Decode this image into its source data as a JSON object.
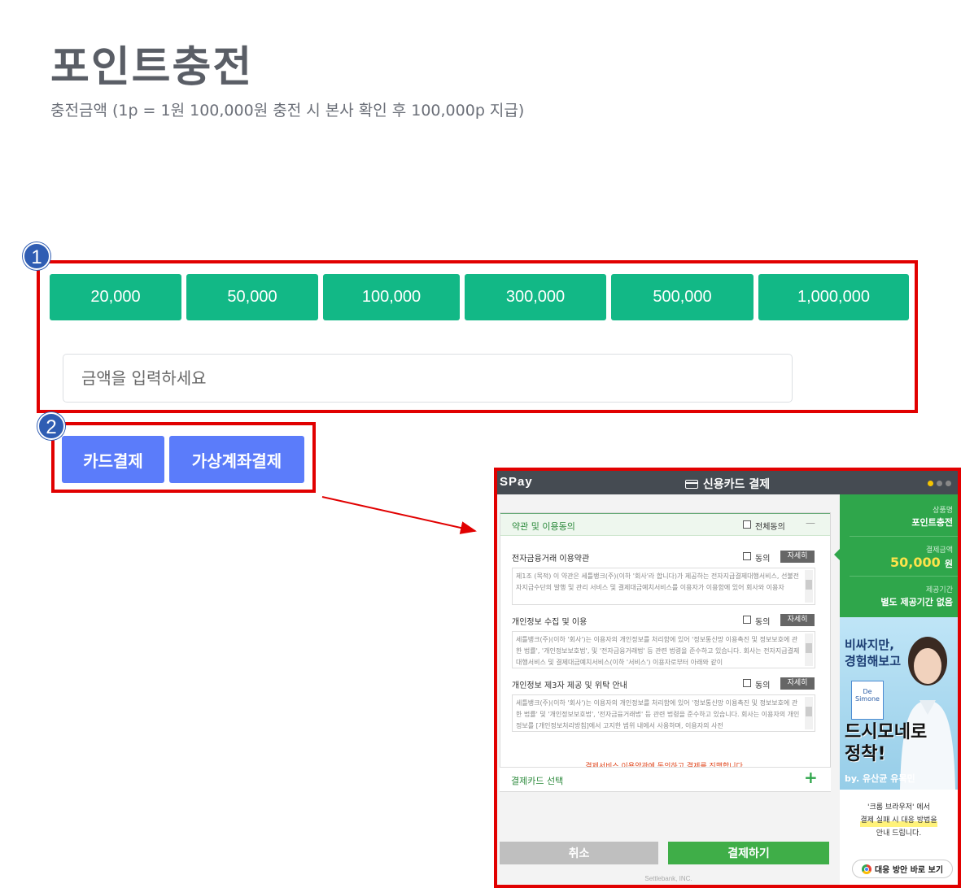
{
  "page": {
    "title": "포인트충전",
    "subtitle": "충전금액 (1p = 1원 100,000원 충전 시 본사 확인 후 100,000p 지급)"
  },
  "annotations": {
    "badge1": "1",
    "badge2": "2",
    "color": "#e10000"
  },
  "amount_buttons": [
    "20,000",
    "50,000",
    "100,000",
    "300,000",
    "500,000",
    "1,000,000"
  ],
  "amount_input": {
    "placeholder": "금액을 입력하세요",
    "value": ""
  },
  "payment_buttons": {
    "card": "카드결제",
    "virtual_account": "가상계좌결제"
  },
  "popup": {
    "logo": "SPay",
    "title": "신용카드 결제",
    "terms": {
      "header": "약관 및 이용동의",
      "agree_all": "전체동의",
      "collapse": "—",
      "items": [
        {
          "title": "전자금융거래 이용약관",
          "agree": "동의",
          "detail": "자세히",
          "text": "제1조 (목적) 이 약관은 세틀뱅크(주)(이하 '회사'라 합니다)가 제공하는 전자지급결제대행서비스, 선불전자지급수단의 발행 및 관리 서비스 및 결제대금예치서비스를 이용자가 이용함에 있어 회사와 이용자"
        },
        {
          "title": "개인정보 수집 및 이용",
          "agree": "동의",
          "detail": "자세히",
          "text": "세틀뱅크(주)(이하 '회사')는 이용자의 개인정보를 처리함에 있어 '정보통신망 이용촉진 및 정보보호에 관한 법률', '개인정보보호법', 및 '전자금융거래법' 등 관련 법령을 준수하고 있습니다. 회사는 전자지급결제대행서비스 및 결제대금예치서비스(이하 '서비스') 이용자로부터 아래와 같이"
        },
        {
          "title": "개인정보 제3자 제공 및 위탁 안내",
          "agree": "동의",
          "detail": "자세히",
          "text": "세틀뱅크(주)(이하 '회사')는 이용자의 개인정보를 처리함에 있어 '정보통신망 이용촉진 및 정보보호에 관한 법률' 및 '개인정보보호법', '전자금융거래법' 등 관련 법령을 준수하고 있습니다. 회사는 이용자의 개인정보를 [개인정보처리방침]에서 고지한 범위 내에서 사용하며, 이용자의 사전"
        }
      ],
      "notice": "결제서비스 이용약관에 동의하고 결제를 진행합니다."
    },
    "select_card": "결제카드 선택",
    "select_card_toggle": "+",
    "cancel": "취소",
    "pay": "결제하기",
    "footer": "Settlebank, INC.",
    "summary": {
      "product_label": "상품명",
      "product": "포인트충전",
      "amount_label": "결제금액",
      "amount": "50,000",
      "amount_unit": "원",
      "period_label": "제공기간",
      "period": "별도 제공기간 없음"
    },
    "ad": {
      "line1": "비싸지만,",
      "line2": "경험해보고",
      "product": "De Simone",
      "line3": "드시모네로",
      "line4": "정착!",
      "by": "by. 유산균 유목민"
    },
    "browser_note": {
      "line1": "'크롬 브라우저' 에서",
      "line2": "결제 실패 시 대응 방법을",
      "line3": "안내 드립니다.",
      "button": "대응 방안 바로 보기"
    }
  }
}
